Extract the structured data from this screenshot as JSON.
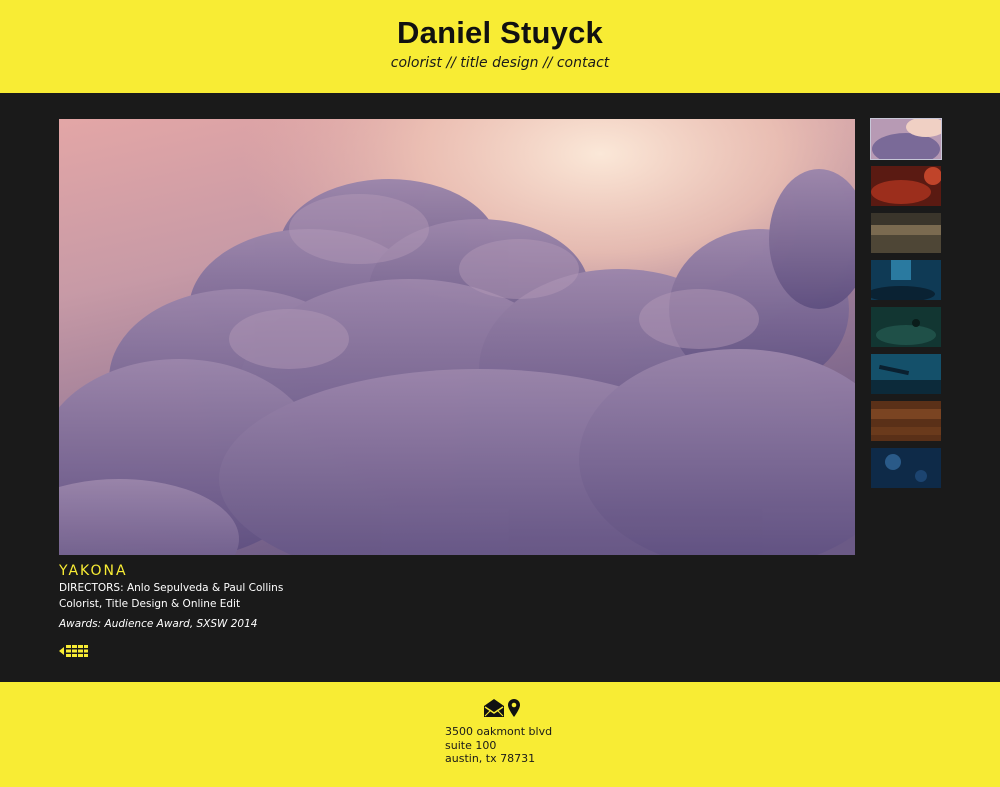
{
  "header": {
    "title": "Daniel Stuyck",
    "nav": [
      {
        "label": "colorist"
      },
      {
        "label": "title design"
      },
      {
        "label": "contact"
      }
    ],
    "separator": " // ",
    "background": "#f8ec34"
  },
  "project": {
    "title": "YAKONA",
    "directors": "DIRECTORS: Anlo Sepulveda & Paul Collins",
    "roles": "Colorist, Title Design & Online Edit",
    "awards": "Awards: Audience Award, SXSW 2014",
    "accent": "#f8ec34"
  },
  "thumbnails": [
    {
      "name": "clouds",
      "active": true
    },
    {
      "name": "red-texture"
    },
    {
      "name": "sepia-landscape"
    },
    {
      "name": "underwater-diver"
    },
    {
      "name": "underwater-divers"
    },
    {
      "name": "underwater-wreck"
    },
    {
      "name": "grass-close-up"
    },
    {
      "name": "blue-water"
    }
  ],
  "icons": {
    "grid": "grid-view-icon",
    "mail": "envelope-icon",
    "location": "map-pin-icon"
  },
  "footer": {
    "address": [
      "3500 oakmont blvd",
      "suite 100",
      "austin, tx 78731"
    ]
  }
}
